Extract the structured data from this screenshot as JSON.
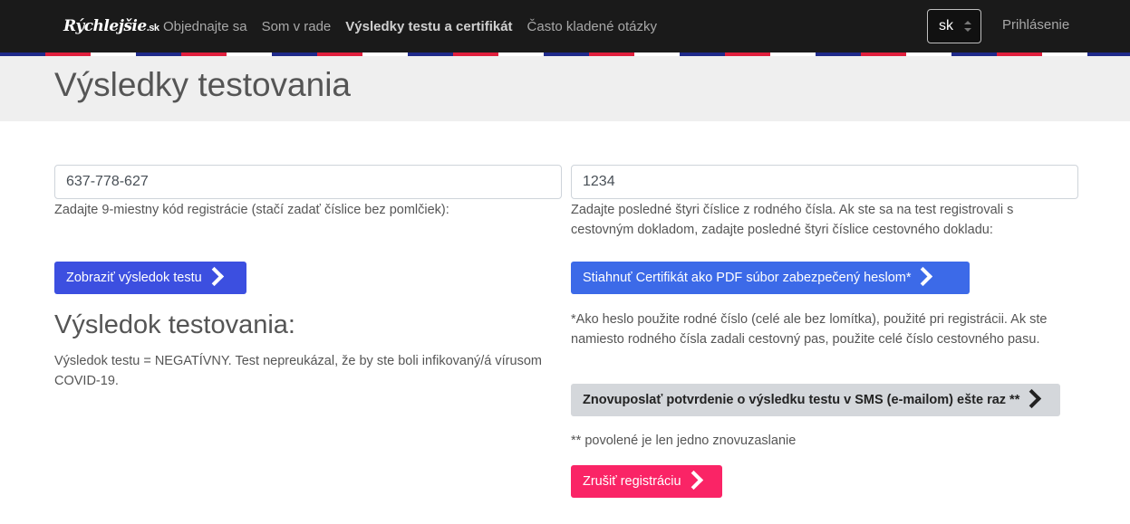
{
  "navbar": {
    "brand": "Rýchlejšie",
    "brand_suffix": ".sk",
    "links": [
      {
        "label": "Objednajte sa"
      },
      {
        "label": "Som v rade"
      },
      {
        "label": "Výsledky testu a certifikát"
      },
      {
        "label": "Často kladené otázky"
      }
    ],
    "language": "sk",
    "login": "Prihlásenie",
    "flag_colors": [
      "#1f2a8a",
      "#e01f3d",
      "#ffffff"
    ]
  },
  "header": {
    "title": "Výsledky testovania"
  },
  "form": {
    "registration_code": {
      "value": "637-778-627",
      "help": "Zadajte 9-miestny kód registrácie (stačí zadať číslice bez pomlčiek):"
    },
    "id_digits": {
      "value": "1234",
      "help": "Zadajte posledné štyri číslice z rodného čísla. Ak ste sa na test registrovali s cestovným dokladom, zadajte posledné štyri číslice cestovného dokladu:"
    },
    "show_result_button": "Zobraziť výsledok testu",
    "download_certificate_button": "Stiahnuť Certifikát ako PDF súbor zabezpečený heslom*",
    "password_note": "*Ako heslo použite rodné číslo (celé ale bez lomítka), použité pri registrácii. Ak ste namiesto rodného čísla zadali cestovný pas, použite celé číslo cestovného pasu.",
    "resend_button": "Znovuposlať potvrdenie o výsledku testu v SMS (e-mailom) ešte raz **",
    "resend_note": "** povolené je len jedno znovuzaslanie",
    "cancel_button": "Zrušiť registráciu"
  },
  "result": {
    "heading": "Výsledok testovania:",
    "text": "Výsledok testu = NEGATÍVNY. Test nepreukázal, že by ste boli infikovaný/á vírusom COVID-19."
  },
  "colors": {
    "primary": "#3c4fe0",
    "danger": "#fa2466",
    "light": "#d4d7db"
  }
}
